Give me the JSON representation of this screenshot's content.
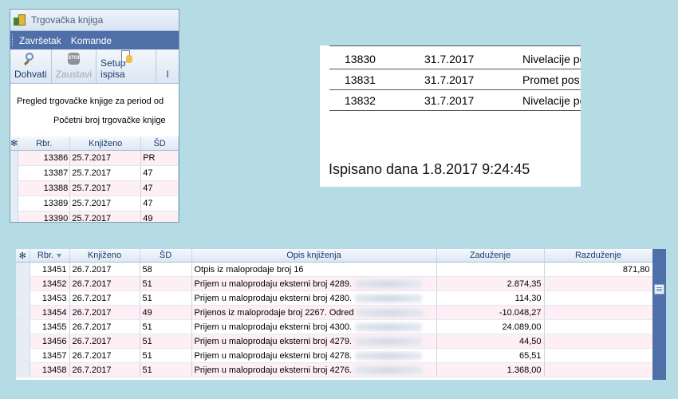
{
  "window1": {
    "title": "Trgovačka knjiga",
    "menu": [
      "Završetak",
      "Komande"
    ],
    "toolbar": {
      "fetch_label": "Dohvati",
      "stop_label": "Zaustavi",
      "stop_icon_text": "STOP",
      "setup_label": "Setup ispisa",
      "next_label": "I"
    },
    "period_label": "Pregled trgovačke knjige za period od",
    "start_number_label": "Početni broj trgovačke knjige",
    "grid_headers": [
      "Rbr.",
      "Knjiženo",
      "ŠD"
    ],
    "rows": [
      {
        "rbr": "13386",
        "date": "25.7.2017",
        "sd": "PR"
      },
      {
        "rbr": "13387",
        "date": "25.7.2017",
        "sd": "47"
      },
      {
        "rbr": "13388",
        "date": "25.7.2017",
        "sd": "47"
      },
      {
        "rbr": "13389",
        "date": "25.7.2017",
        "sd": "47"
      },
      {
        "rbr": "13390",
        "date": "25.7.2017",
        "sd": "49"
      }
    ]
  },
  "preview": {
    "rows": [
      {
        "num": "13830",
        "date": "31.7.2017",
        "desc": "Nivelacije po"
      },
      {
        "num": "13831",
        "date": "31.7.2017",
        "desc": "Promet pos"
      },
      {
        "num": "13832",
        "date": "31.7.2017",
        "desc": "Nivelacije po"
      }
    ],
    "printed": "Ispisano dana 1.8.2017 9:24:45"
  },
  "grid2": {
    "headers": {
      "rbr": "Rbr.",
      "date": "Knjiženo",
      "sd": "ŠD",
      "desc": "Opis knjiženja",
      "debit": "Zaduženje",
      "credit": "Razduženje"
    },
    "rows": [
      {
        "rbr": "13451",
        "date": "26.7.2017",
        "sd": "58",
        "desc": "Otpis iz maloprodaje broj 16",
        "debit": "",
        "credit": "871,80"
      },
      {
        "rbr": "13452",
        "date": "26.7.2017",
        "sd": "51",
        "desc": "Prijem u maloprodaju eksterni broj 4289.",
        "debit": "2.874,35",
        "credit": ""
      },
      {
        "rbr": "13453",
        "date": "26.7.2017",
        "sd": "51",
        "desc": "Prijem u maloprodaju eksterni broj 4280.",
        "debit": "114,30",
        "credit": ""
      },
      {
        "rbr": "13454",
        "date": "26.7.2017",
        "sd": "49",
        "desc": "Prijenos iz maloprodaje broj 2267. Odred",
        "debit": "-10.048,27",
        "credit": ""
      },
      {
        "rbr": "13455",
        "date": "26.7.2017",
        "sd": "51",
        "desc": "Prijem u maloprodaju eksterni broj 4300.",
        "debit": "24.089,00",
        "credit": ""
      },
      {
        "rbr": "13456",
        "date": "26.7.2017",
        "sd": "51",
        "desc": "Prijem u maloprodaju eksterni broj 4279.",
        "debit": "44,50",
        "credit": ""
      },
      {
        "rbr": "13457",
        "date": "26.7.2017",
        "sd": "51",
        "desc": "Prijem u maloprodaju eksterni broj 4278.",
        "debit": "65,51",
        "credit": ""
      },
      {
        "rbr": "13458",
        "date": "26.7.2017",
        "sd": "51",
        "desc": "Prijem u maloprodaju eksterni broj 4276.",
        "debit": "1.368,00",
        "credit": ""
      }
    ]
  },
  "colors": {
    "background": "#b5dbe5",
    "menubar": "#4f6fa8",
    "alt_row": "#fdeff4"
  }
}
